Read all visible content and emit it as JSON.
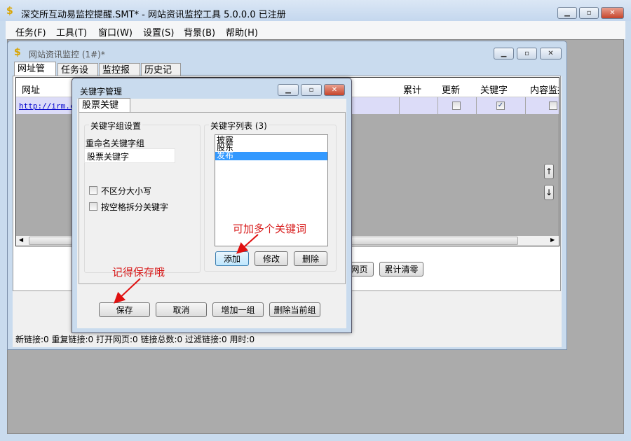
{
  "app": {
    "title": "深交所互动易监控提醒.SMT* - 网站资讯监控工具 5.0.0.0  已注册"
  },
  "menu": [
    "任务(F)",
    "工具(T)",
    "窗口(W)",
    "设置(S)",
    "背景(B)",
    "帮助(H)"
  ],
  "child": {
    "title": "网站资讯监控  (1#)*",
    "tabs": [
      "网址管理",
      "任务设置",
      "监控报警",
      "历史记录"
    ],
    "columns": [
      "网址",
      "累计",
      "更新",
      "关键字",
      "内容监控"
    ],
    "row": {
      "url": "http://irm.cn",
      "update": false,
      "keyword": true,
      "content": false
    },
    "buttons": {
      "webpage": "网页",
      "reset": "累计清零"
    },
    "status": "新链接:0  重复链接:0  打开网页:0  链接总数:0  过滤链接:0  用时:0"
  },
  "dialog": {
    "title": "关键字管理",
    "tab": "股票关键字",
    "group_settings": "关键字组设置",
    "rename_label": "重命名关键字组",
    "rename_value": "股票关键字",
    "case_insensitive": "不区分大小写",
    "split_space": "按空格拆分关键字",
    "list_label": "关键字列表 (3)",
    "keywords": [
      "披露",
      "股东",
      "发布"
    ],
    "selected_index": 2,
    "add": "添加",
    "edit": "修改",
    "delete": "删除",
    "save": "保存",
    "cancel": "取消",
    "add_group": "增加一组",
    "delete_group": "删除当前组"
  },
  "annotations": {
    "add_hint": "可加多个关键词",
    "save_hint": "记得保存哦"
  }
}
